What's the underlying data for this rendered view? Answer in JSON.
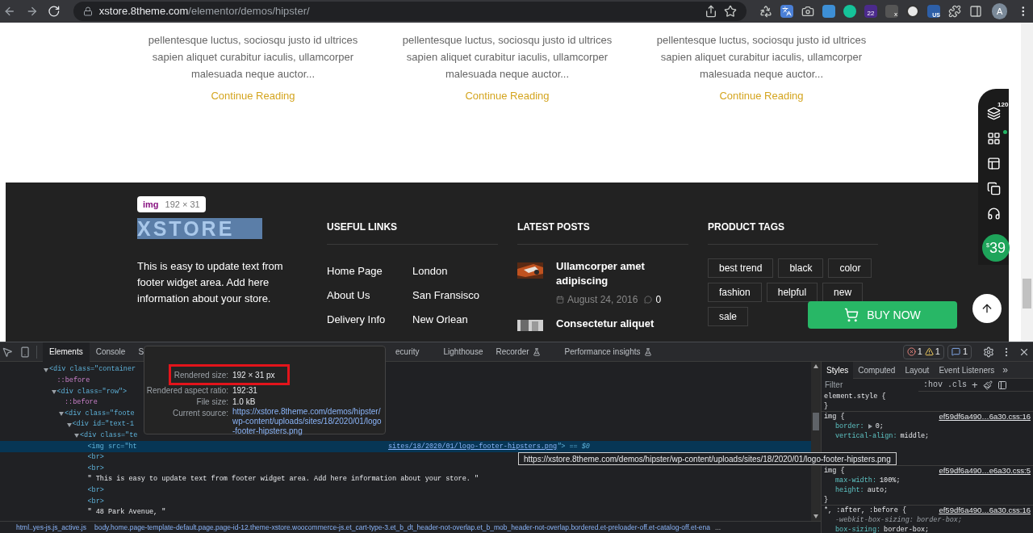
{
  "browser": {
    "url_host": "xstore.8theme.com",
    "url_path": "/elementor/demos/hipster/",
    "extensions": [
      {
        "kind": "recycle"
      },
      {
        "kind": "translate"
      },
      {
        "kind": "camera"
      },
      {
        "kind": "s-square"
      },
      {
        "kind": "g-circle"
      },
      {
        "kind": "counter",
        "label": "22"
      },
      {
        "kind": "corner",
        "label": "x"
      },
      {
        "kind": "s-circle"
      },
      {
        "kind": "flag",
        "label": "US"
      },
      {
        "kind": "puzzle"
      },
      {
        "kind": "sidebar"
      }
    ],
    "profile_initial": "A"
  },
  "blog_excerpts": [
    {
      "text": "pellentesque luctus, sociosqu justo id ultrices sapien aliquet curabitur iaculis, ullamcorper malesuada neque auctor...",
      "link": "Continue Reading"
    },
    {
      "text": "pellentesque luctus, sociosqu justo id ultrices sapien aliquet curabitur iaculis, ullamcorper malesuada neque auctor...",
      "link": "Continue Reading"
    },
    {
      "text": "pellentesque luctus, sociosqu justo id ultrices sapien aliquet curabitur iaculis, ullamcorper malesuada neque auctor...",
      "link": "Continue Reading"
    }
  ],
  "footer": {
    "logo_text": "XSTORE",
    "about": "This is easy to update text from footer widget area. Add here information about your store.",
    "useful_links": {
      "title": "USEFUL LINKS",
      "links": [
        "Home Page",
        "London",
        "About Us",
        "San Fransisco",
        "Delivery Info",
        "New Orlean"
      ]
    },
    "latest_posts": {
      "title": "LATEST POSTS",
      "posts": [
        {
          "title": "Ullamcorper amet adipiscing",
          "date": "August 24, 2016",
          "comments": "0"
        },
        {
          "title": "Consectetur aliquet"
        }
      ]
    },
    "product_tags": {
      "title": "PRODUCT TAGS",
      "tags": [
        "best trend",
        "black",
        "color",
        "fashion",
        "helpful",
        "new",
        "sale"
      ]
    }
  },
  "side_toolbar": {
    "badge": "120",
    "currency": "$",
    "price": "39"
  },
  "buy_now": "BUY NOW",
  "element_badge": {
    "tag": "img",
    "size": "192 × 31"
  },
  "devtools": {
    "tabs": [
      {
        "label": "Elements",
        "selected": true,
        "flask": false
      },
      {
        "label": "Console",
        "selected": false,
        "flask": false
      },
      {
        "label": "S",
        "selected": false,
        "flask": false
      },
      {
        "label": "ecurity",
        "selected": false,
        "flask": false
      },
      {
        "label": "Lighthouse",
        "selected": false,
        "flask": false
      },
      {
        "label": "Recorder",
        "selected": false,
        "flask": true
      },
      {
        "label": "Performance insights",
        "selected": false,
        "flask": true
      }
    ],
    "issues": [
      {
        "kind": "error",
        "count": "1"
      },
      {
        "kind": "warning",
        "count": "1"
      }
    ],
    "messages": "1",
    "tree": [
      {
        "kind": "tag",
        "text": "<div class=\"container",
        "expanded": true,
        "children": [
          {
            "kind": "pseudo",
            "text": "::before"
          },
          {
            "kind": "tag",
            "text": "<div class=\"row\">",
            "expanded": true,
            "children": [
              {
                "kind": "pseudo",
                "text": "::before"
              },
              {
                "kind": "tag",
                "text": "<div class=\"foote",
                "expanded": true,
                "children": [
                  {
                    "kind": "tag",
                    "text": "<div id=\"text-1",
                    "expanded": true,
                    "children": [
                      {
                        "kind": "tag",
                        "text": "<div class=\"te",
                        "expanded": true,
                        "children": [
                          {
                            "kind": "tag",
                            "text": "<img src=\"ht",
                            "selected": true,
                            "continuation": "sites/18/2020/01/logo-footer-hipsters.png",
                            "suffix": "\"> == $0"
                          },
                          {
                            "kind": "tag",
                            "text": "<br>",
                            "selected": false
                          },
                          {
                            "kind": "tag",
                            "text": "<br>",
                            "selected": false
                          },
                          {
                            "kind": "text",
                            "text": "\" This is easy to update text from footer widget area. Add here information about your store. \"",
                            "selected": false
                          },
                          {
                            "kind": "tag",
                            "text": "<br>",
                            "selected": false
                          },
                          {
                            "kind": "tag",
                            "text": "<br>",
                            "selected": false
                          },
                          {
                            "kind": "text",
                            "text": "\" 48 Park Avenue, \"",
                            "selected": false
                          }
                        ]
                      }
                    ]
                  }
                ]
              }
            ]
          }
        ]
      }
    ],
    "image_popup": {
      "rows": [
        {
          "label": "Rendered size:",
          "value": "192 × 31 px",
          "highlighted": true
        },
        {
          "label": "Rendered aspect ratio:",
          "value": "192∶31",
          "highlighted": false
        },
        {
          "label": "File size:",
          "value": "1.0 kB",
          "highlighted": false
        }
      ],
      "source_label": "Current source:",
      "source": "https://xstore.8theme.com/demos/hipster/wp-content/uploads/sites/18/2020/01/logo-footer-hipsters.png"
    },
    "url_tooltip": "https://xstore.8theme.com/demos/hipster/wp-content/uploads/sites/18/2020/01/logo-footer-hipsters.png",
    "breadcrumbs": [
      "html..yes-js.js_active.js",
      "body.home.page-template-default.page.page-id-12.theme-xstore.woocommerce-js.et_cart-type-3.et_b_dt_header-not-overlap.et_b_mob_header-not-overlap.bordered.et-preloader-off.et-catalog-off.et-ena"
    ],
    "breadcrumb_more": "...",
    "styles": {
      "tabs": [
        {
          "label": "Styles",
          "selected": true
        },
        {
          "label": "Computed",
          "selected": false
        },
        {
          "label": "Layout",
          "selected": false
        },
        {
          "label": "Event Listeners",
          "selected": false
        }
      ],
      "more": "»",
      "filter_placeholder": "Filter",
      "hov": ":hov",
      "cls": ".cls",
      "add": "+",
      "rules": [
        {
          "selector": "element.style {",
          "close": "}"
        },
        {
          "selector": "img {",
          "source": "ef59df6a490…6a30.css:16",
          "declarations": [
            {
              "prop": "border:",
              "value": "0;",
              "expandable": true,
              "struck": false
            },
            {
              "prop": "vertical-align:",
              "value": "middle;",
              "expandable": false,
              "struck": false
            }
          ]
        },
        {
          "selector": "img {",
          "source": "ef59df6a490…e6a30.css:5",
          "declarations": [
            {
              "prop": "max-width:",
              "value": "100%;",
              "expandable": false,
              "struck": false
            },
            {
              "prop": "height:",
              "value": "auto;",
              "expandable": false,
              "struck": false
            }
          ],
          "close": "}"
        },
        {
          "selector": "*, :after, :before {",
          "source": "ef59df6a490…6a30.css:16",
          "declarations": [
            {
              "prop": "-webkit-box-sizing:",
              "value": "border-box;",
              "expandable": false,
              "struck": true
            },
            {
              "prop": "box-sizing:",
              "value": "border-box;",
              "expandable": false,
              "struck": false
            }
          ]
        }
      ]
    }
  }
}
